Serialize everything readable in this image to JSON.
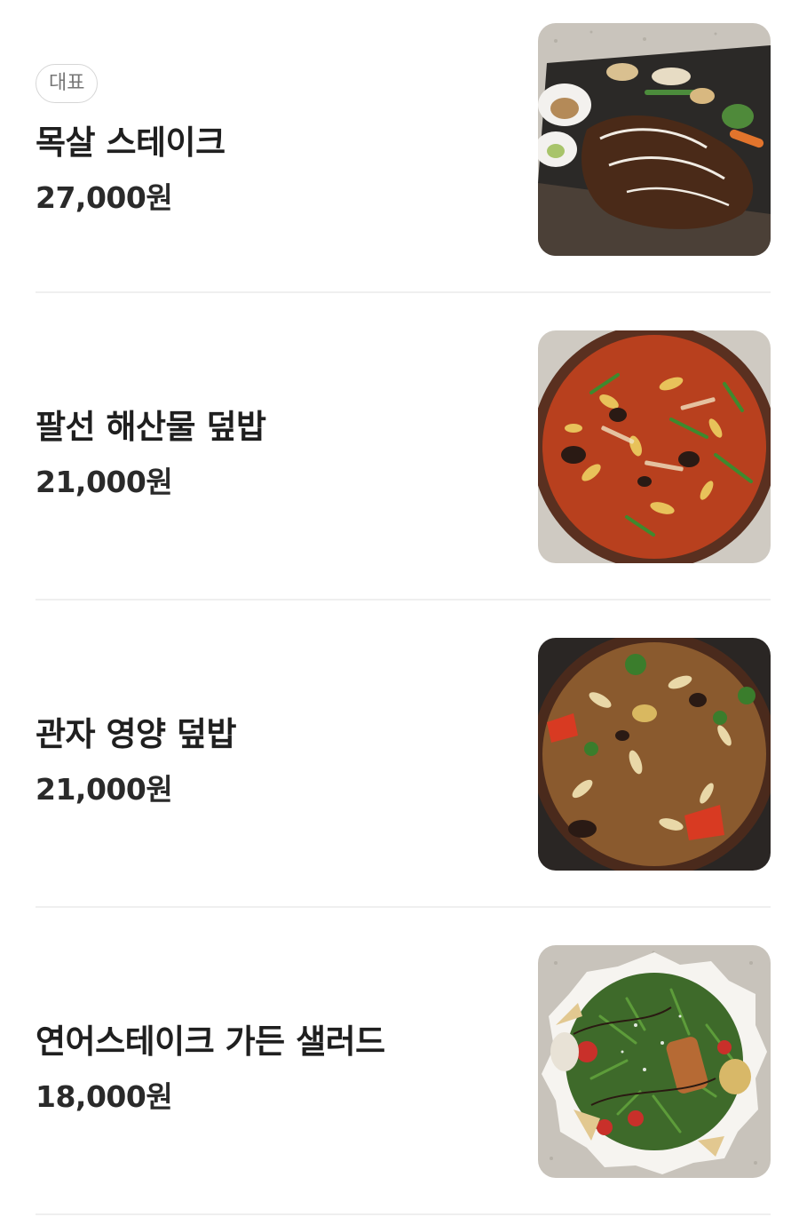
{
  "menu": {
    "items": [
      {
        "badge": "대표",
        "name": "목살 스테이크",
        "price": "27,000원",
        "image": "pork-steak-photo"
      },
      {
        "badge": "",
        "name": "팔선 해산물 덮밥",
        "price": "21,000원",
        "image": "seafood-rice-bowl-photo"
      },
      {
        "badge": "",
        "name": "관자 영양 덮밥",
        "price": "21,000원",
        "image": "scallop-rice-bowl-photo"
      },
      {
        "badge": "",
        "name": "연어스테이크 가든 샐러드",
        "price": "18,000원",
        "image": "salmon-salad-photo"
      }
    ]
  }
}
